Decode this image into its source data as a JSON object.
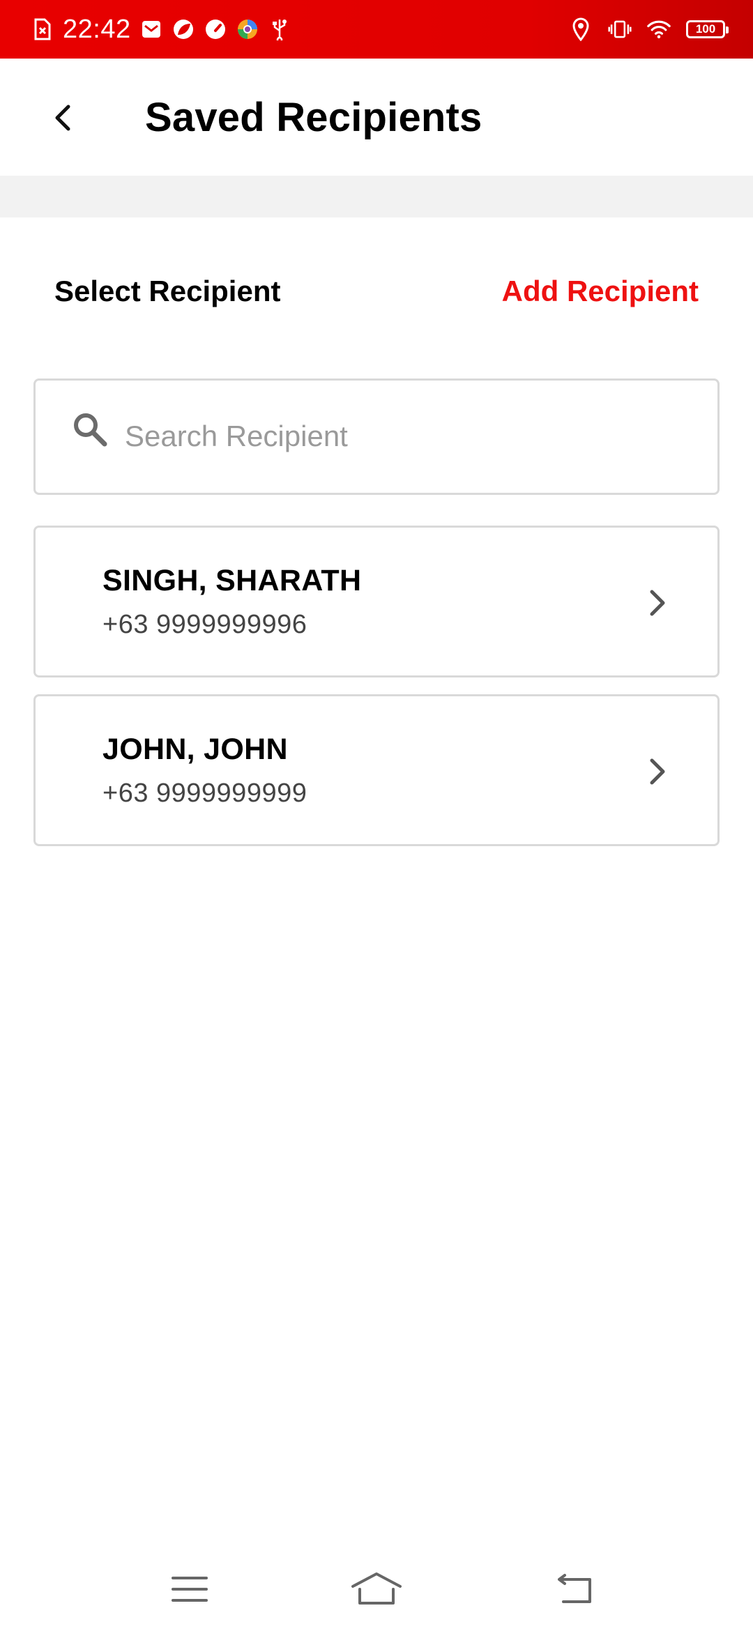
{
  "status_bar": {
    "time": "22:42",
    "battery_level": "100",
    "icons_left": [
      "screenshot-error-icon",
      "mail-icon",
      "leaf-app-icon",
      "speedometer-icon",
      "browser-icon",
      "usb-icon"
    ],
    "icons_right": [
      "location-icon",
      "vibrate-icon",
      "wifi-icon",
      "battery-icon"
    ],
    "colors": {
      "background": "#e80000",
      "foreground": "#ffffff"
    }
  },
  "app_bar": {
    "title": "Saved Recipients",
    "back_icon": "chevron-left-icon"
  },
  "section": {
    "select_label": "Select Recipient",
    "add_label": "Add Recipient",
    "accent_color": "#ee1111"
  },
  "search": {
    "placeholder": "Search Recipient",
    "value": "",
    "icon": "search-icon"
  },
  "recipients": [
    {
      "name": "SINGH, SHARATH",
      "phone": "+63 9999999996"
    },
    {
      "name": "JOHN, JOHN",
      "phone": "+63 9999999999"
    }
  ],
  "nav_bar": {
    "items": [
      "menu-icon",
      "home-icon",
      "back-icon"
    ]
  }
}
